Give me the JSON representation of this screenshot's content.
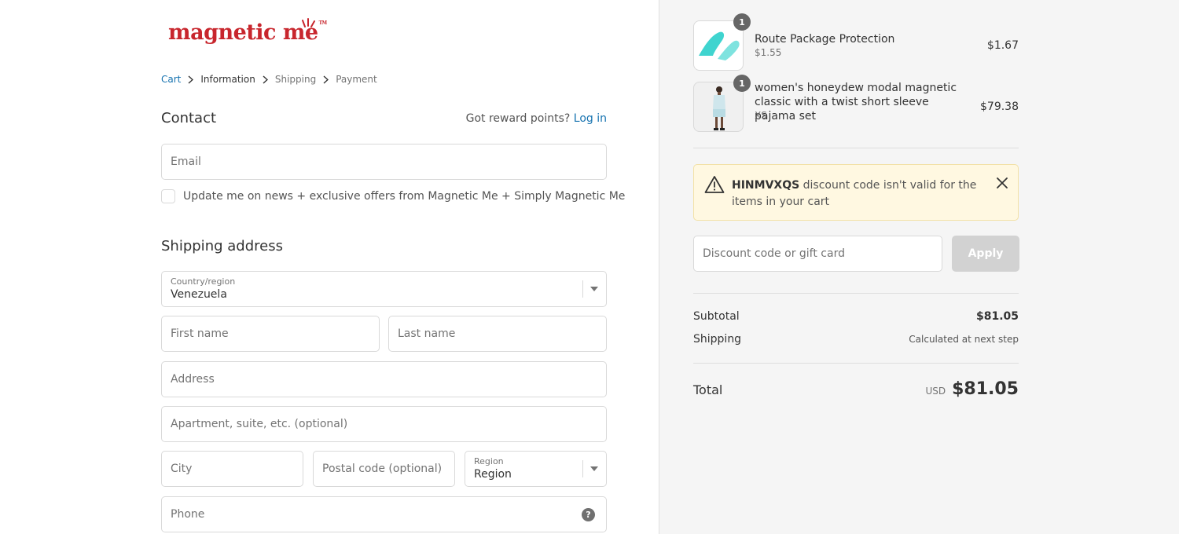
{
  "brand": {
    "logo_text": "magnetic me",
    "logo_mark": "TM",
    "accent": "#c8262d"
  },
  "breadcrumb": [
    "Cart",
    "Information",
    "Shipping",
    "Payment"
  ],
  "contact": {
    "title": "Contact",
    "reward_prompt": "Got reward points?",
    "login_link": "Log in",
    "email_placeholder": "Email",
    "newsletter_label": "Update me on news + exclusive offers from Magnetic Me + Simply Magnetic Me"
  },
  "shipping": {
    "title": "Shipping address",
    "country_label": "Country/region",
    "country_value": "Venezuela",
    "first_name_placeholder": "First name",
    "last_name_placeholder": "Last name",
    "address_placeholder": "Address",
    "apartment_placeholder": "Apartment, suite, etc. (optional)",
    "city_placeholder": "City",
    "postal_placeholder": "Postal code (optional)",
    "region_label": "Region",
    "region_value": "Region",
    "phone_placeholder": "Phone",
    "phone_help": "?"
  },
  "cart": {
    "items": [
      {
        "name": "Route Package Protection",
        "subtitle": "$1.55",
        "price": "$1.67",
        "quantity": "1",
        "icon": "route-logo-icon"
      },
      {
        "name": "women's honeydew modal magnetic classic with a twist short sleeve pajama set",
        "subtitle": "XS",
        "price": "$79.38",
        "quantity": "1",
        "icon": "pajama-product-image"
      }
    ]
  },
  "discount": {
    "warning_code": "HINMVXQS",
    "warning_message": "discount code isn't valid for the items in your cart",
    "placeholder": "Discount code or gift card",
    "apply_label": "Apply"
  },
  "summary": {
    "subtotal_label": "Subtotal",
    "subtotal_value": "$81.05",
    "shipping_label": "Shipping",
    "shipping_value": "Calculated at next step",
    "total_label": "Total",
    "currency": "USD",
    "total_value": "$81.05"
  }
}
